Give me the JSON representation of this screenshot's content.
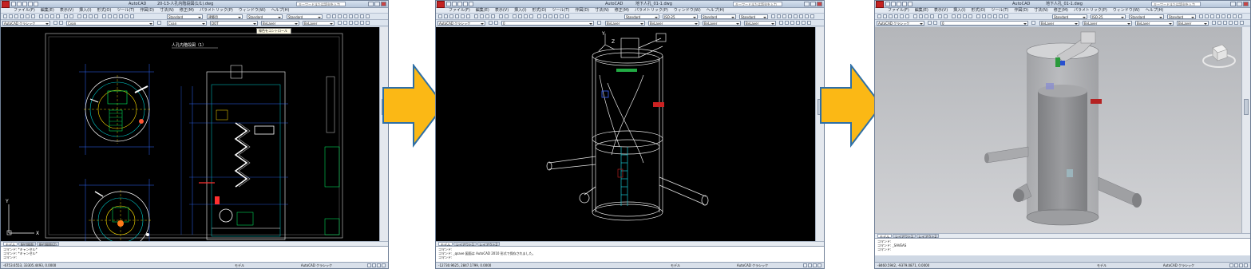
{
  "windows": [
    {
      "title": "20-13-人孔内階段図(1/1).dwg",
      "app_name": "AutoCAD",
      "search_placeholder": "キーワードまたは語句を入力",
      "menus": [
        "ファイル(F)",
        "編集(E)",
        "表示(V)",
        "挿入(I)",
        "形式(O)",
        "ツール(T)",
        "作図(D)",
        "寸法(N)",
        "修正(M)",
        "パラメトリック(P)",
        "ウィンドウ(W)",
        "ヘルプ(H)"
      ],
      "workspace_combo": "AutoCAD クラシック",
      "layer_combo": "Cyan",
      "linetype_combo": "DOT",
      "lineweight_combo": "ByLayer",
      "color_combo": "ByLayer",
      "text_style": "Standard",
      "dim_style": "建築用",
      "table_style": "Standard",
      "tooltip": "線色をコントロール",
      "drawing_title": "人孔内階段図（1）",
      "tabs": [
        "モデル",
        "配付図面",
        "配付図面(2)"
      ],
      "command_lines": [
        "コマンド: *キャンセル*",
        "コマンド: *キャンセル*",
        "コマンド:"
      ],
      "coordinates": "-6753.6553, 33305.4493, 0.0000",
      "status_model": "モデル",
      "status_workspace": "AutoCAD クラシック"
    },
    {
      "title": "地下人孔_01-1.dwg",
      "app_name": "AutoCAD",
      "search_placeholder": "キーワードまたは語句を入力",
      "menus": [
        "ファイル(F)",
        "編集(E)",
        "表示(V)",
        "挿入(I)",
        "形式(O)",
        "ツール(T)",
        "作図(D)",
        "寸法(N)",
        "修正(M)",
        "パラメトリック(P)",
        "ウィンドウ(W)",
        "ヘルプ(H)"
      ],
      "workspace_combo": "AutoCAD クラシック",
      "layer_combo": "0",
      "linetype_combo": "ByLayer",
      "lineweight_combo": "ByLayer",
      "color_combo": "ByLayer",
      "text_style": "Standard",
      "dim_style": "ISO-25",
      "table_style": "Standard",
      "tabs": [
        "モデル",
        "レイアウト1",
        "レイアウト2"
      ],
      "command_lines": [
        "コマンド:",
        "コマンド: _qsave 図面は AutoCAD 2010 形式で保存されました。",
        "コマンド:"
      ],
      "coordinates": "-12730.9625, 2847.1799, 0.0000",
      "status_model": "モデル",
      "status_workspace": "AutoCAD クラシック"
    },
    {
      "title": "地下人孔_01-1.dwg",
      "app_name": "AutoCAD",
      "search_placeholder": "キーワードまたは語句を入力",
      "menus": [
        "ファイル(F)",
        "編集(E)",
        "表示(V)",
        "挿入(I)",
        "形式(O)",
        "ツール(T)",
        "作図(D)",
        "寸法(N)",
        "修正(M)",
        "パラメトリック(P)",
        "ウィンドウ(W)",
        "ヘルプ(H)"
      ],
      "workspace_combo": "AutoCAD クラシック",
      "layer_combo": "0",
      "linetype_combo": "ByLayer",
      "lineweight_combo": "ByLayer",
      "color_combo": "ByLayer",
      "text_style": "Standard",
      "dim_style": "ISO-25",
      "table_style": "Standard",
      "tabs": [
        "モデル",
        "レイアウト1",
        "レイアウト2"
      ],
      "command_lines": [
        "コマンド:",
        "コマンド: _SAVEAS",
        "コマンド:"
      ],
      "coordinates": "-8460.5942, -9379.0871, 0.0000",
      "status_model": "モデル",
      "status_workspace": "AutoCAD クラシック"
    }
  ],
  "colors": {
    "arrow_fill": "#fbb815",
    "arrow_stroke": "#2e6fa6",
    "drawing_bg": "#000000",
    "shaded_bg": "#c6c7ca"
  }
}
